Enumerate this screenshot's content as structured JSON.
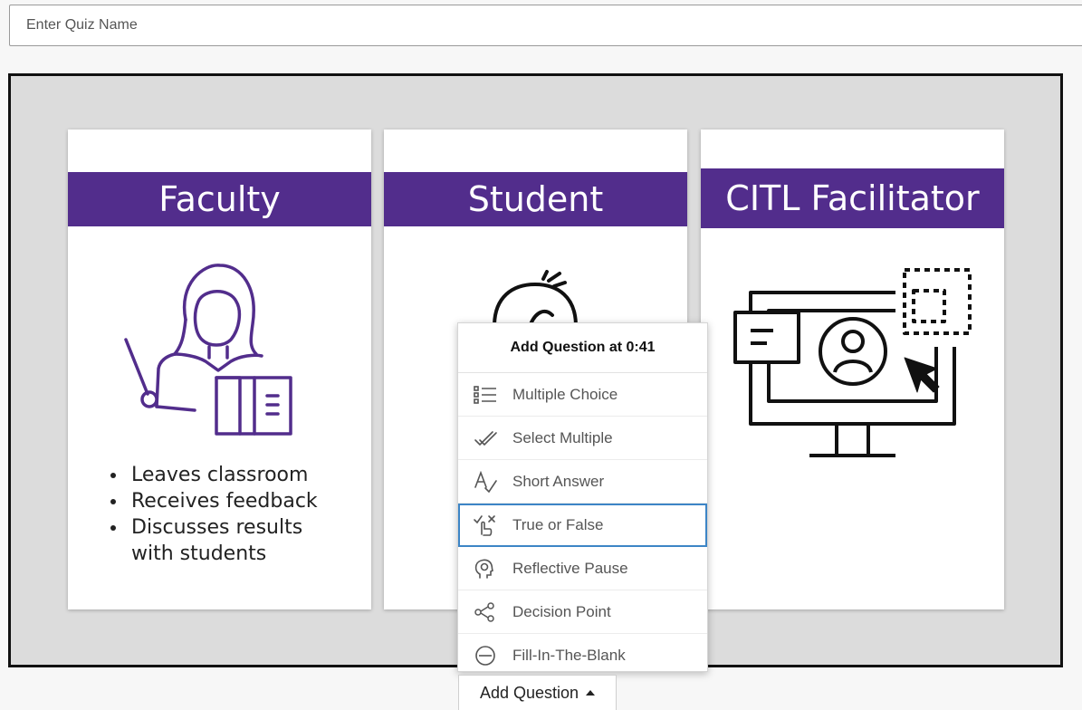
{
  "quiz": {
    "name_value": "",
    "name_placeholder": "Enter Quiz Name"
  },
  "slide": {
    "cards": [
      {
        "title": "Faculty",
        "bullets": [
          "Leaves classroom",
          "Receives feedback",
          "Discusses results",
          "with students"
        ],
        "icon": "teacher-icon"
      },
      {
        "title": "Student",
        "icon": "student-face-icon"
      },
      {
        "title": "CITL Facilitator",
        "icon": "computer-user-icon"
      }
    ],
    "colors": {
      "banner": "#522d8c",
      "art_faculty": "#522d8c",
      "art_citl": "#111111"
    }
  },
  "menu": {
    "header": "Add Question at 0:41",
    "items": [
      {
        "label": "Multiple Choice",
        "icon": "list-icon"
      },
      {
        "label": "Select Multiple",
        "icon": "double-check-icon"
      },
      {
        "label": "Short Answer",
        "icon": "text-answer-icon"
      },
      {
        "label": "True or False",
        "icon": "true-false-icon",
        "selected": true
      },
      {
        "label": "Reflective Pause",
        "icon": "head-idea-icon"
      },
      {
        "label": "Decision Point",
        "icon": "share-nodes-icon"
      },
      {
        "label": "Fill-In-The-Blank",
        "icon": "blank-circle-icon"
      }
    ],
    "selected_color": "#3d85c6"
  },
  "add_button": {
    "label": "Add Question",
    "icon": "caret-up-icon"
  }
}
